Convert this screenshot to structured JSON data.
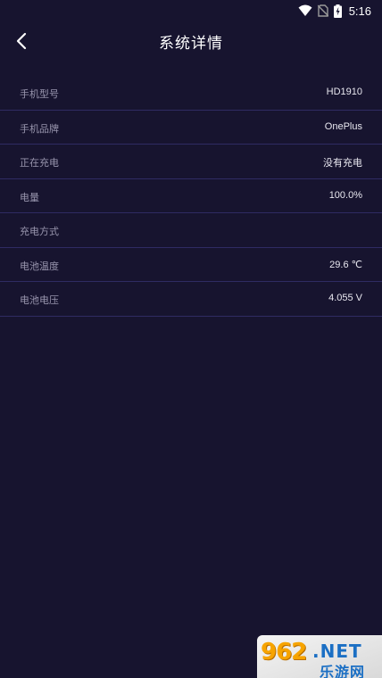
{
  "status_bar": {
    "time": "5:16",
    "icons": [
      "wifi-icon",
      "no-sim-icon",
      "battery-charging-icon"
    ]
  },
  "header": {
    "back_icon": "chevron-left-icon",
    "title": "系统详情"
  },
  "info": {
    "rows": [
      {
        "label": "手机型号",
        "value": "HD1910"
      },
      {
        "label": "手机品牌",
        "value": "OnePlus"
      },
      {
        "label": "正在充电",
        "value": "没有充电"
      },
      {
        "label": "电量",
        "value": "100.0%"
      },
      {
        "label": "充电方式",
        "value": ""
      },
      {
        "label": "电池温度",
        "value": "29.6 ℃"
      },
      {
        "label": "电池电压",
        "value": "4.055 V"
      }
    ]
  },
  "watermark": {
    "num": "962",
    "net": ".NET",
    "sub": "乐游网"
  },
  "colors": {
    "background": "#17142f",
    "divider": "#2f2b63",
    "label": "#9895ad",
    "value": "#e9e8f0",
    "title": "#ffffff"
  }
}
